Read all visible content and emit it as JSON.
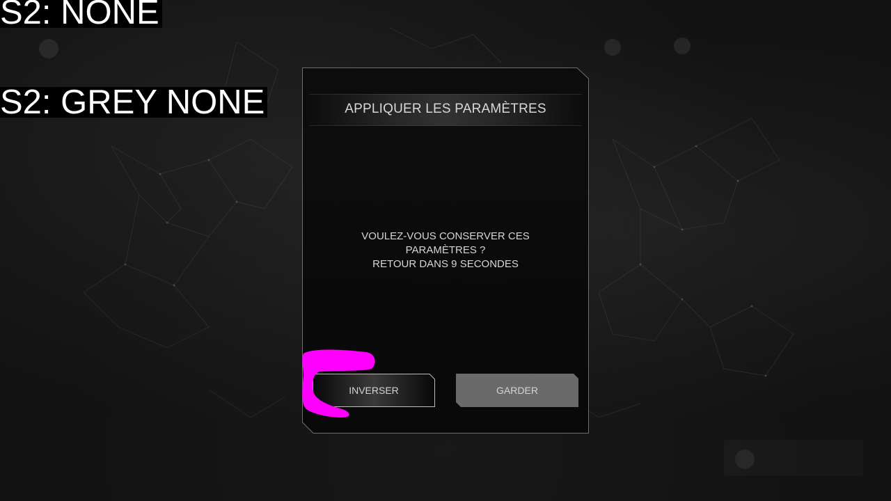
{
  "debug": {
    "line1": "S2: NONE",
    "line2": "S2: GREY NONE"
  },
  "dialog": {
    "title": "APPLIQUER LES PARAMÈTRES",
    "message_line1": "VOULEZ-VOUS CONSERVER CES PARAMÈTRES ?",
    "message_line2": "RETOUR DANS 9 SECONDES",
    "buttons": {
      "invert_label": "INVERSER",
      "keep_label": "GARDER"
    }
  },
  "colors": {
    "background": "#121212",
    "dialog_border": "#6e6e6e",
    "keep_button_fill": "#6a6a6a",
    "focus_highlight": "#ff00ff"
  }
}
